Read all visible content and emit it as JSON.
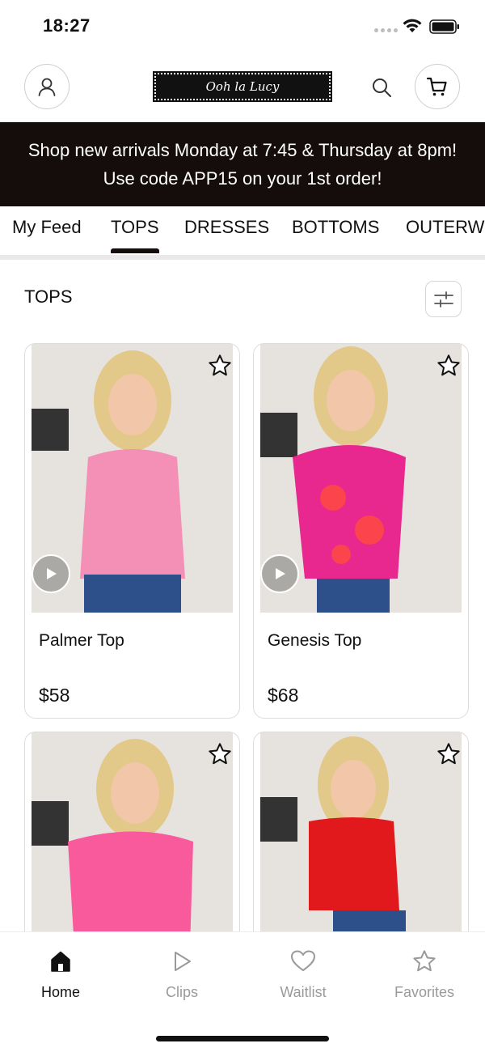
{
  "status_bar": {
    "time": "18:27"
  },
  "header": {
    "logo_text": "Ooh la Lucy",
    "icons": {
      "account": "user-icon",
      "search": "search-icon",
      "cart": "cart-icon"
    }
  },
  "promo_banner": {
    "text": "Shop new arrivals Monday at 7:45 & Thursday at 8pm! Use code APP15 on your 1st order!"
  },
  "category_tabs": [
    {
      "label": "My Feed",
      "active": false
    },
    {
      "label": "TOPS",
      "active": true
    },
    {
      "label": "DRESSES",
      "active": false
    },
    {
      "label": "BOTTOMS",
      "active": false
    },
    {
      "label": "OUTERW",
      "active": false
    }
  ],
  "section": {
    "title": "TOPS",
    "filter_icon": "sliders-icon"
  },
  "products": [
    {
      "name": "Palmer Top",
      "price": "$58",
      "has_video": true,
      "top_color": "#f48fb5"
    },
    {
      "name": "Genesis Top",
      "price": "$68",
      "has_video": true,
      "top_color": "#e8288f"
    },
    {
      "name": "",
      "price": "",
      "has_video": false,
      "top_color": "#f85a9c"
    },
    {
      "name": "",
      "price": "",
      "has_video": false,
      "top_color": "#e2191c"
    }
  ],
  "bottom_nav": [
    {
      "label": "Home",
      "icon": "home-icon",
      "active": true
    },
    {
      "label": "Clips",
      "icon": "play-icon",
      "active": false
    },
    {
      "label": "Waitlist",
      "icon": "heart-icon",
      "active": false
    },
    {
      "label": "Favorites",
      "icon": "star-icon",
      "active": false
    }
  ],
  "colors": {
    "banner_bg": "#150c0c",
    "accent": "#150c0c",
    "inactive": "#9a9a9a"
  }
}
